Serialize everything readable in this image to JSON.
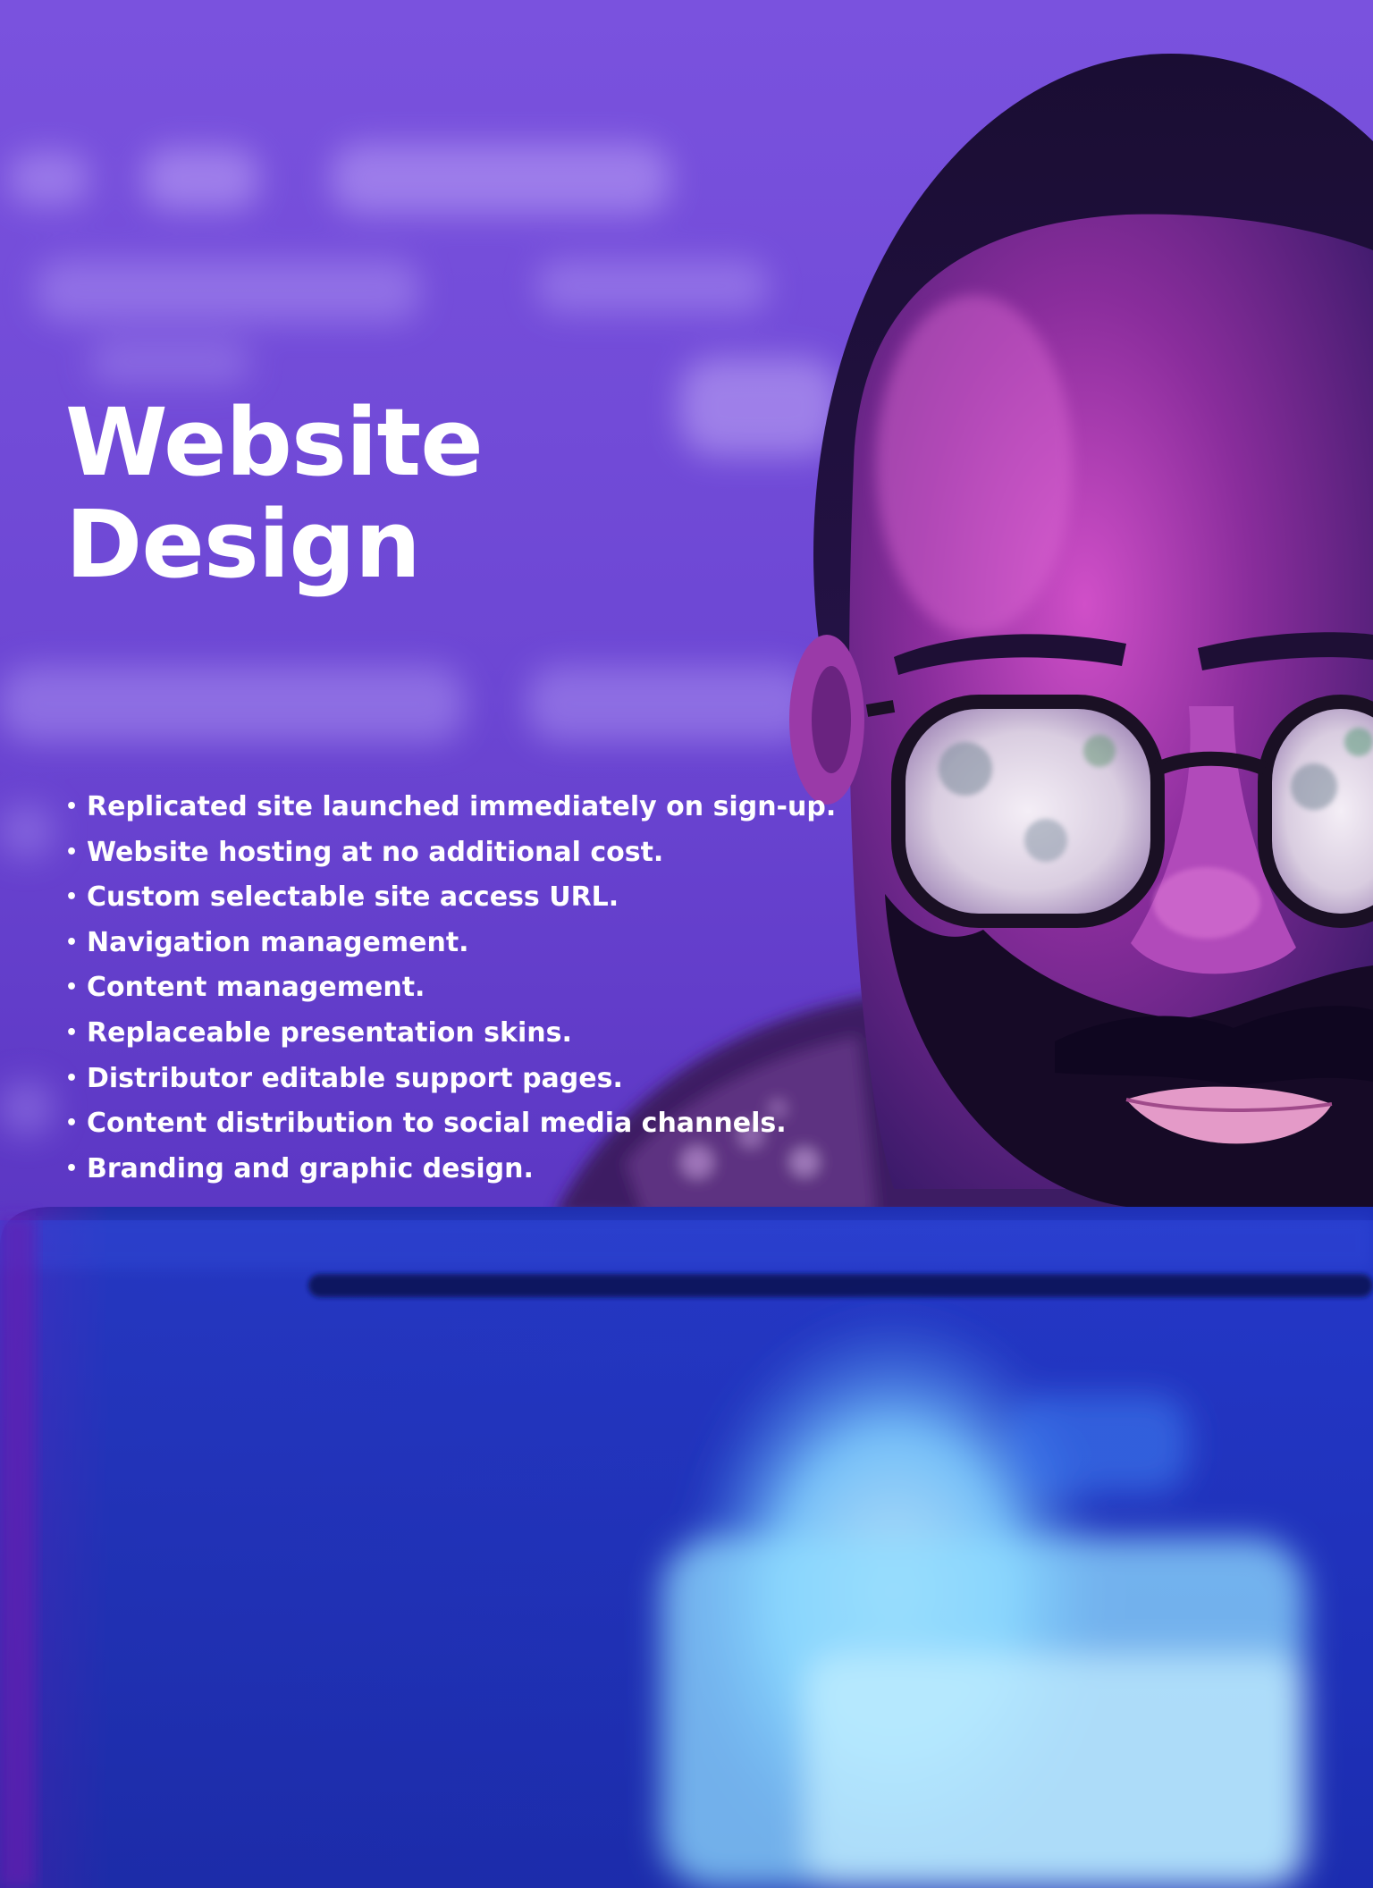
{
  "headline": {
    "line1": "Website",
    "line2": "Design"
  },
  "features": [
    "Replicated site launched immediately on sign-up.",
    "Website hosting at no additional cost.",
    "Custom selectable site access URL.",
    "Navigation management.",
    "Content management.",
    "Replaceable presentation skins.",
    "Distributor editable support pages.",
    "Content distribution to social media channels.",
    "Branding and graphic design."
  ],
  "bullet": "•",
  "colors": {
    "background": "#7450d8",
    "laptop": "#1e2fb8",
    "screen_glow": "#8fd8ff",
    "text": "#ffffff"
  }
}
